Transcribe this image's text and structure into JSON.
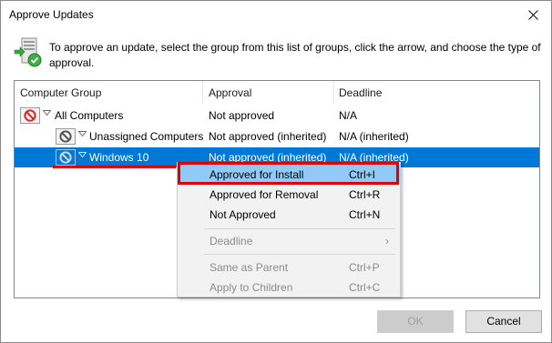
{
  "window": {
    "title": "Approve Updates"
  },
  "header": {
    "instructions": "To approve an update, select the group from this list of groups, click the arrow, and choose the type of approval."
  },
  "columns": [
    "Computer Group",
    "Approval",
    "Deadline"
  ],
  "rows": [
    {
      "group": "All Computers",
      "approval": "Not approved",
      "deadline": "N/A",
      "icon": "blocked-red-icon",
      "selected": false
    },
    {
      "group": "Unassigned Computers",
      "approval": "Not approved (inherited)",
      "deadline": "N/A (inherited)",
      "icon": "blocked-gray-icon",
      "selected": false
    },
    {
      "group": "Windows 10",
      "approval": "Not approved (inherited)",
      "deadline": "N/A (inherited)",
      "icon": "blocked-gray-icon",
      "selected": true
    }
  ],
  "context_menu": {
    "items": [
      {
        "label": "Approved for Install",
        "shortcut": "Ctrl+I",
        "enabled": true,
        "highlighted": true
      },
      {
        "label": "Approved for Removal",
        "shortcut": "Ctrl+R",
        "enabled": true
      },
      {
        "label": "Not Approved",
        "shortcut": "Ctrl+N",
        "enabled": true
      },
      {
        "label": "Deadline",
        "shortcut": "",
        "enabled": false,
        "submenu": true
      },
      {
        "label": "Same as Parent",
        "shortcut": "Ctrl+P",
        "enabled": false
      },
      {
        "label": "Apply to Children",
        "shortcut": "Ctrl+C",
        "enabled": false
      }
    ],
    "submenu_glyph": "›"
  },
  "buttons": {
    "ok": {
      "label": "OK",
      "enabled": false
    },
    "cancel": {
      "label": "Cancel",
      "enabled": true
    }
  },
  "colors": {
    "selection": "#0078d7",
    "menu_highlight": "#91c9f7",
    "annotation_red": "#e00000",
    "blocked_red": "#e0241c"
  }
}
